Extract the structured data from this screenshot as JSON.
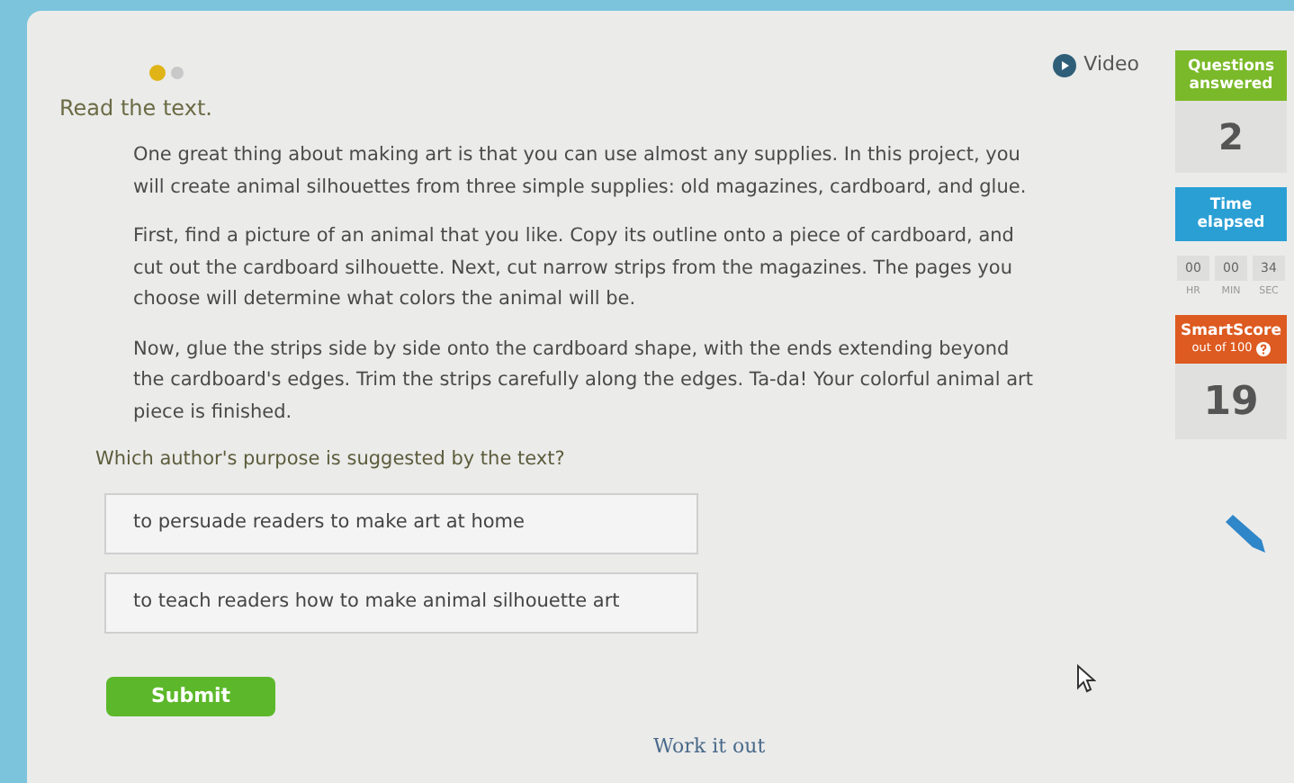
{
  "video": {
    "label": "Video"
  },
  "progress_dots": [
    {
      "selected": true
    },
    {
      "selected": false
    }
  ],
  "instruction": "Read the text.",
  "paragraphs": [
    "One great thing about making art is that you can use almost any supplies. In this project, you will create animal silhouettes from three simple supplies: old magazines, cardboard, and glue.",
    "First, find a picture of an animal that you like. Copy its outline onto a piece of cardboard, and cut out the cardboard silhouette. Next, cut narrow strips from the magazines. The pages you choose will determine what colors the animal will be.",
    "Now, glue the strips side by side onto the cardboard shape, with the ends extending beyond the cardboard's edges. Trim the strips carefully along the edges. Ta-da! Your colorful animal art piece is finished."
  ],
  "question": "Which author's purpose is suggested by the text?",
  "choices": [
    {
      "label": "to persuade readers to make art at home",
      "selected": false
    },
    {
      "label": "to teach readers how to make animal silhouette art",
      "selected": false
    }
  ],
  "submit": "Submit",
  "work_it_out": "Work it out",
  "stats": {
    "questions_header": "Questions answered",
    "questions_value": "2",
    "time_header": "Time elapsed",
    "time": [
      {
        "value": "00",
        "unit": "HR"
      },
      {
        "value": "00",
        "unit": "MIN"
      },
      {
        "value": "34",
        "unit": "SEC"
      }
    ],
    "score_header": "SmartScore",
    "score_sub": "out of 100",
    "score_value": "19"
  }
}
